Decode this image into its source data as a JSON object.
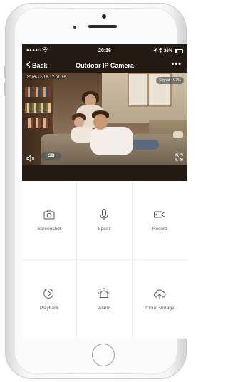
{
  "status_bar": {
    "signal": "●●●●○",
    "time": "20:16",
    "battery": "26%"
  },
  "nav": {
    "back_label": "Back",
    "title": "Outdoor IP Camera",
    "more_label": "•••"
  },
  "video": {
    "timestamp": "2016-12-16 17:01:16",
    "signal_label": "Signal : 97%",
    "quality_label": "SD"
  },
  "actions": [
    {
      "label": "Screenshot",
      "icon": "camera-icon"
    },
    {
      "label": "Speak",
      "icon": "microphone-icon"
    },
    {
      "label": "Record",
      "icon": "video-record-icon"
    },
    {
      "label": "Playback",
      "icon": "playback-icon"
    },
    {
      "label": "Alarm",
      "icon": "alarm-icon"
    },
    {
      "label": "Cloud storage",
      "icon": "cloud-storage-icon"
    }
  ]
}
